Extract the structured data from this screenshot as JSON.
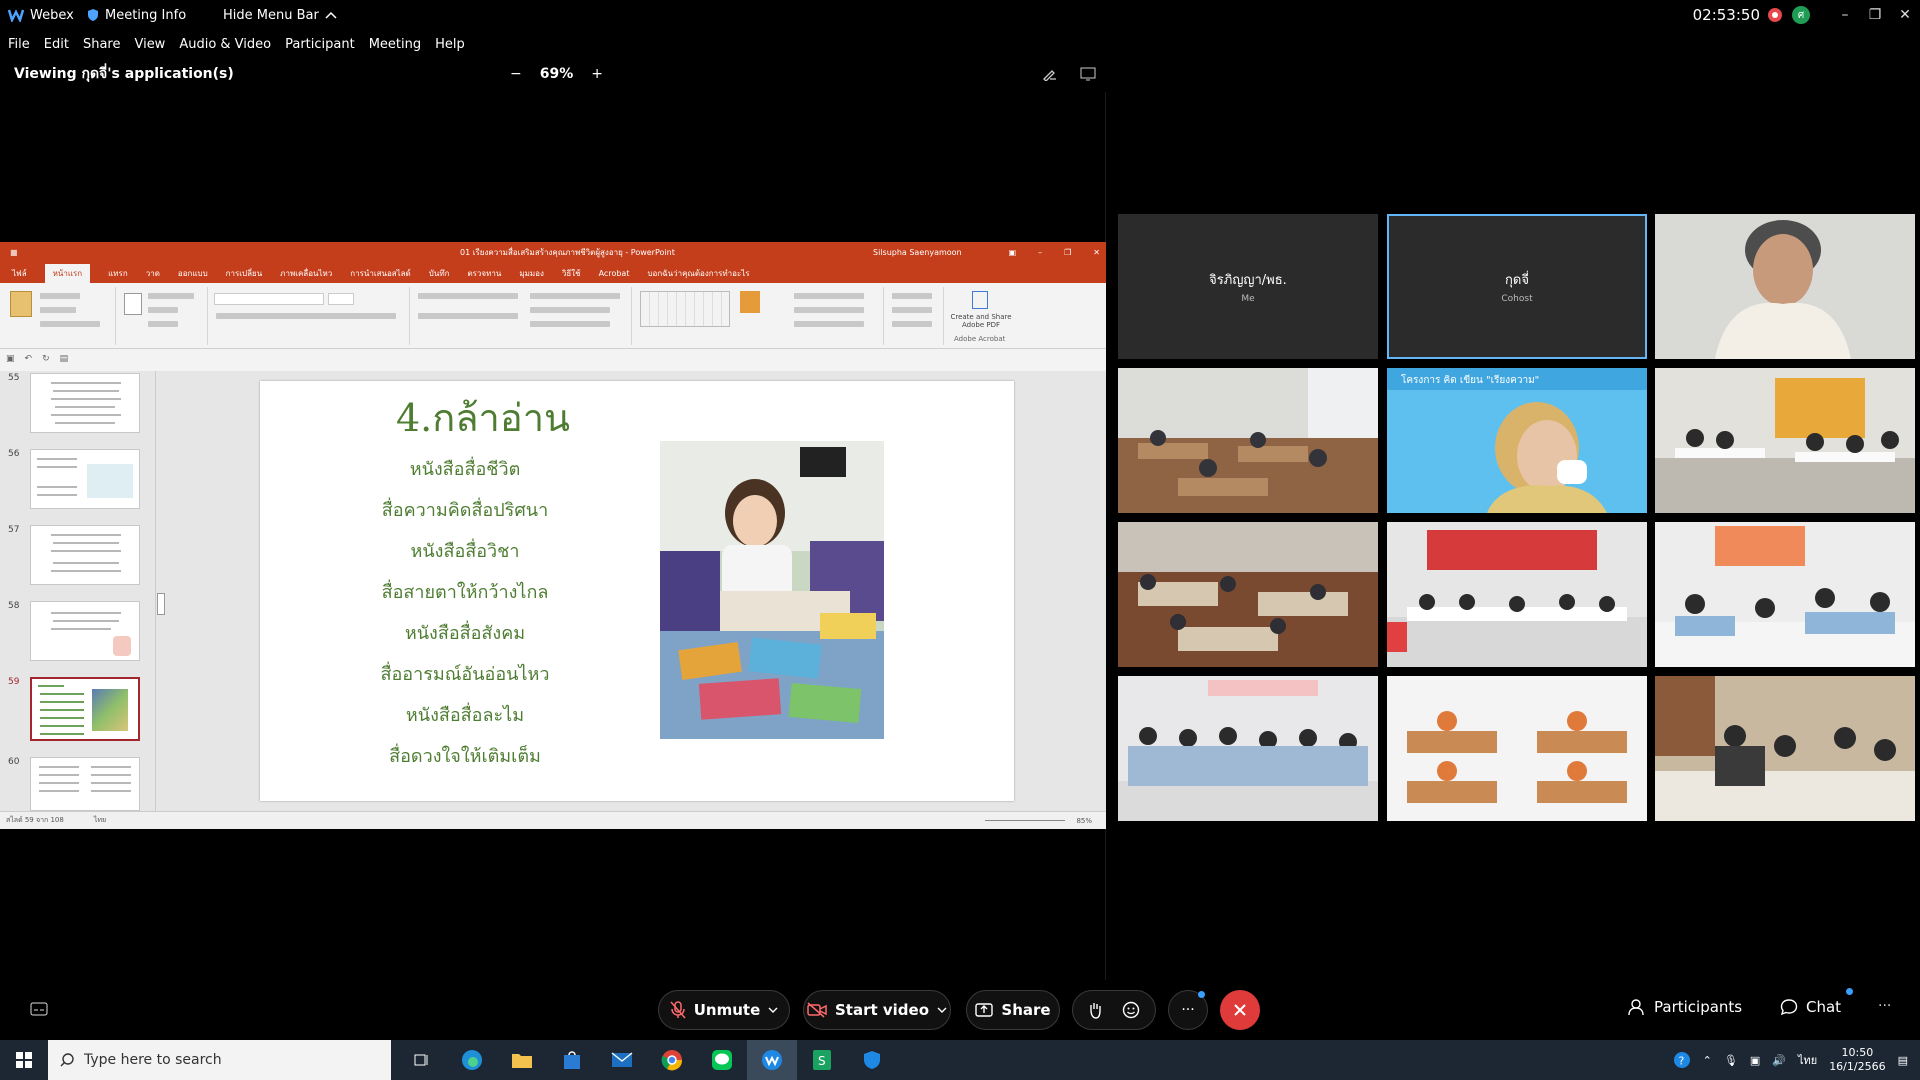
{
  "titlebar": {
    "app_name": "Webex",
    "meeting_info": "Meeting Info",
    "hide_menu_bar": "Hide Menu Bar",
    "clock": "02:53:50",
    "avatar_initial": "ศ"
  },
  "menu": {
    "items": [
      "File",
      "Edit",
      "Share",
      "View",
      "Audio & Video",
      "Participant",
      "Meeting",
      "Help"
    ]
  },
  "viewing": {
    "label": "Viewing กุดจี่'s application(s)",
    "zoom": "69%"
  },
  "ppt": {
    "doc_title": "01 เรียงความสื่อเสริมสร้างคุณภาพชีวิตผู้สูงอายุ - PowerPoint",
    "user": "Silsupha Saenyamoon",
    "tabs": [
      "ไฟล์",
      "หน้าแรก",
      "แทรก",
      "วาด",
      "ออกแบบ",
      "การเปลี่ยน",
      "ภาพเคลื่อนไหว",
      "การนำเสนอสไลด์",
      "บันทึก",
      "ตรวจทาน",
      "มุมมอง",
      "วิธีใช้",
      "Acrobat",
      "บอกฉันว่าคุณต้องการทำอะไร"
    ],
    "create_pdf": "Create and Share Adobe PDF",
    "adobe_acrobat": "Adobe Acrobat",
    "thumb_numbers": [
      "55",
      "56",
      "57",
      "58",
      "59",
      "60"
    ],
    "status_left": "สไลด์ 59 จาก 108",
    "status_lang": "ไทย",
    "status_zoom": "85%"
  },
  "slide": {
    "title": "4.กล้าอ่าน",
    "lines": [
      "หนังสือสื่อชีวิต",
      "สื่อความคิดสื่อปริศนา",
      "หนังสือสื่อวิชา",
      "สื่อสายตาให้กว้างไกล",
      "หนังสือสื่อสังคม",
      "สื่ออารมณ์อันอ่อนไหว",
      "หนังสือสื่อละไม",
      "สื่อดวงใจให้เติมเต็ม"
    ]
  },
  "participants": [
    {
      "name": "จิรภิญญา/พธ.",
      "role": "Me"
    },
    {
      "name": "กุดจี่",
      "role": "Cohost"
    }
  ],
  "video_banner": "โครงการ คิด เขียน \"เรียงความ\"",
  "controls": {
    "unmute": "Unmute",
    "start_video": "Start video",
    "share": "Share",
    "more": "···",
    "participants": "Participants",
    "chat": "Chat"
  },
  "taskbar": {
    "search_placeholder": "Type here to search",
    "time": "10:50",
    "date": "16/1/2566",
    "lang": "ไทย"
  },
  "colors": {
    "ppt_accent": "#c43e1c",
    "slide_text": "#4e7d32",
    "end_call": "#e03b3b",
    "active_tile_border": "#64b5f6"
  }
}
